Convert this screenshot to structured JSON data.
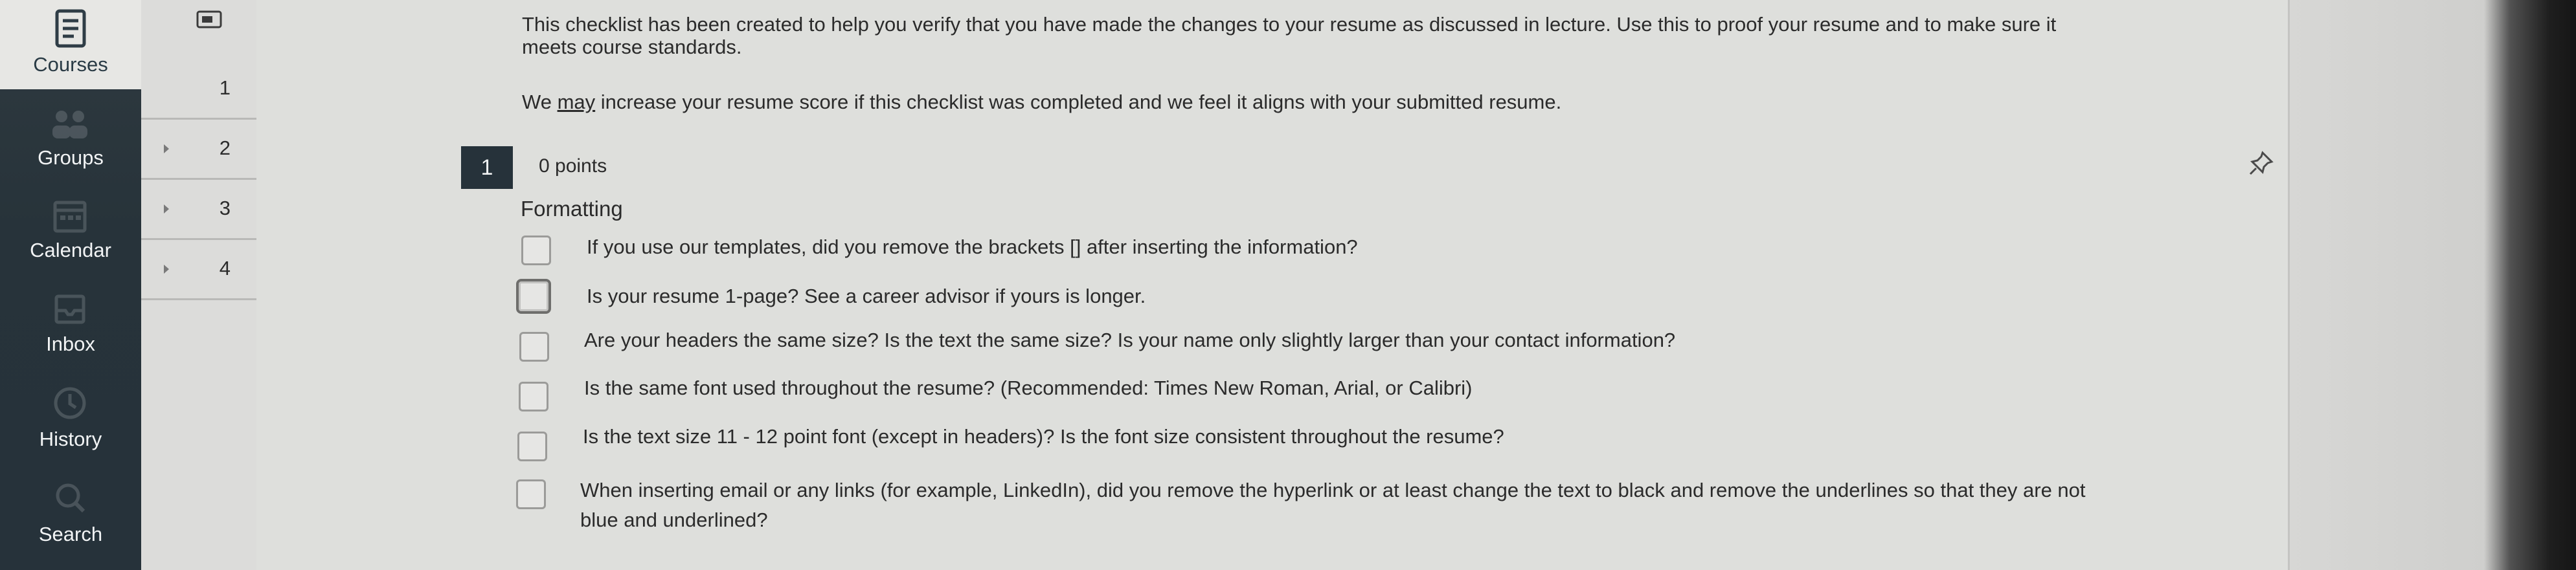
{
  "global_nav": {
    "items": [
      {
        "label": "Courses",
        "icon": "courses-icon",
        "active": true
      },
      {
        "label": "Groups",
        "icon": "groups-icon"
      },
      {
        "label": "Calendar",
        "icon": "calendar-icon"
      },
      {
        "label": "Inbox",
        "icon": "inbox-icon"
      },
      {
        "label": "History",
        "icon": "history-icon"
      },
      {
        "label": "Search",
        "icon": "search-icon"
      }
    ]
  },
  "question_nav": {
    "items": [
      "1",
      "2",
      "3",
      "4"
    ]
  },
  "intro": {
    "line1": "This checklist has been created to help you verify that you have made the changes to your resume as discussed in lecture.  Use this to proof your resume and to make sure it",
    "line2": "meets course standards.",
    "note_pre": "We ",
    "note_emph": "may",
    "note_post": " increase your resume score if this checklist was completed and we feel it aligns with your submitted resume."
  },
  "question": {
    "number": "1",
    "points": "0 points",
    "section": "Formatting",
    "options": [
      "If you use our templates, did you remove the brackets [] after inserting the information?",
      "Is your resume 1-page? See a career advisor if yours is longer.",
      "Are your headers the same size? Is the text the same size? Is your name only slightly larger than your contact information?",
      "Is the same font used throughout the resume? (Recommended: Times New Roman, Arial, or Calibri)",
      "Is the text size 11 - 12 point font (except in headers)? Is the font size consistent throughout the resume?",
      "When inserting email or any links (for example, LinkedIn), did you remove the hyperlink or at least change the text to black and remove the underlines so that they are not"
    ],
    "option6_line2": "blue and underlined?"
  }
}
